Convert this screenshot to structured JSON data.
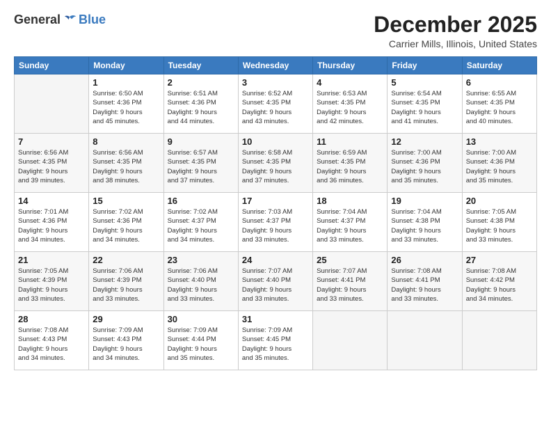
{
  "header": {
    "logo_general": "General",
    "logo_blue": "Blue",
    "title": "December 2025",
    "location": "Carrier Mills, Illinois, United States"
  },
  "days_of_week": [
    "Sunday",
    "Monday",
    "Tuesday",
    "Wednesday",
    "Thursday",
    "Friday",
    "Saturday"
  ],
  "weeks": [
    [
      {
        "day": "",
        "info": ""
      },
      {
        "day": "1",
        "info": "Sunrise: 6:50 AM\nSunset: 4:36 PM\nDaylight: 9 hours\nand 45 minutes."
      },
      {
        "day": "2",
        "info": "Sunrise: 6:51 AM\nSunset: 4:36 PM\nDaylight: 9 hours\nand 44 minutes."
      },
      {
        "day": "3",
        "info": "Sunrise: 6:52 AM\nSunset: 4:35 PM\nDaylight: 9 hours\nand 43 minutes."
      },
      {
        "day": "4",
        "info": "Sunrise: 6:53 AM\nSunset: 4:35 PM\nDaylight: 9 hours\nand 42 minutes."
      },
      {
        "day": "5",
        "info": "Sunrise: 6:54 AM\nSunset: 4:35 PM\nDaylight: 9 hours\nand 41 minutes."
      },
      {
        "day": "6",
        "info": "Sunrise: 6:55 AM\nSunset: 4:35 PM\nDaylight: 9 hours\nand 40 minutes."
      }
    ],
    [
      {
        "day": "7",
        "info": "Sunrise: 6:56 AM\nSunset: 4:35 PM\nDaylight: 9 hours\nand 39 minutes."
      },
      {
        "day": "8",
        "info": "Sunrise: 6:56 AM\nSunset: 4:35 PM\nDaylight: 9 hours\nand 38 minutes."
      },
      {
        "day": "9",
        "info": "Sunrise: 6:57 AM\nSunset: 4:35 PM\nDaylight: 9 hours\nand 37 minutes."
      },
      {
        "day": "10",
        "info": "Sunrise: 6:58 AM\nSunset: 4:35 PM\nDaylight: 9 hours\nand 37 minutes."
      },
      {
        "day": "11",
        "info": "Sunrise: 6:59 AM\nSunset: 4:35 PM\nDaylight: 9 hours\nand 36 minutes."
      },
      {
        "day": "12",
        "info": "Sunrise: 7:00 AM\nSunset: 4:36 PM\nDaylight: 9 hours\nand 35 minutes."
      },
      {
        "day": "13",
        "info": "Sunrise: 7:00 AM\nSunset: 4:36 PM\nDaylight: 9 hours\nand 35 minutes."
      }
    ],
    [
      {
        "day": "14",
        "info": "Sunrise: 7:01 AM\nSunset: 4:36 PM\nDaylight: 9 hours\nand 34 minutes."
      },
      {
        "day": "15",
        "info": "Sunrise: 7:02 AM\nSunset: 4:36 PM\nDaylight: 9 hours\nand 34 minutes."
      },
      {
        "day": "16",
        "info": "Sunrise: 7:02 AM\nSunset: 4:37 PM\nDaylight: 9 hours\nand 34 minutes."
      },
      {
        "day": "17",
        "info": "Sunrise: 7:03 AM\nSunset: 4:37 PM\nDaylight: 9 hours\nand 33 minutes."
      },
      {
        "day": "18",
        "info": "Sunrise: 7:04 AM\nSunset: 4:37 PM\nDaylight: 9 hours\nand 33 minutes."
      },
      {
        "day": "19",
        "info": "Sunrise: 7:04 AM\nSunset: 4:38 PM\nDaylight: 9 hours\nand 33 minutes."
      },
      {
        "day": "20",
        "info": "Sunrise: 7:05 AM\nSunset: 4:38 PM\nDaylight: 9 hours\nand 33 minutes."
      }
    ],
    [
      {
        "day": "21",
        "info": "Sunrise: 7:05 AM\nSunset: 4:39 PM\nDaylight: 9 hours\nand 33 minutes."
      },
      {
        "day": "22",
        "info": "Sunrise: 7:06 AM\nSunset: 4:39 PM\nDaylight: 9 hours\nand 33 minutes."
      },
      {
        "day": "23",
        "info": "Sunrise: 7:06 AM\nSunset: 4:40 PM\nDaylight: 9 hours\nand 33 minutes."
      },
      {
        "day": "24",
        "info": "Sunrise: 7:07 AM\nSunset: 4:40 PM\nDaylight: 9 hours\nand 33 minutes."
      },
      {
        "day": "25",
        "info": "Sunrise: 7:07 AM\nSunset: 4:41 PM\nDaylight: 9 hours\nand 33 minutes."
      },
      {
        "day": "26",
        "info": "Sunrise: 7:08 AM\nSunset: 4:41 PM\nDaylight: 9 hours\nand 33 minutes."
      },
      {
        "day": "27",
        "info": "Sunrise: 7:08 AM\nSunset: 4:42 PM\nDaylight: 9 hours\nand 34 minutes."
      }
    ],
    [
      {
        "day": "28",
        "info": "Sunrise: 7:08 AM\nSunset: 4:43 PM\nDaylight: 9 hours\nand 34 minutes."
      },
      {
        "day": "29",
        "info": "Sunrise: 7:09 AM\nSunset: 4:43 PM\nDaylight: 9 hours\nand 34 minutes."
      },
      {
        "day": "30",
        "info": "Sunrise: 7:09 AM\nSunset: 4:44 PM\nDaylight: 9 hours\nand 35 minutes."
      },
      {
        "day": "31",
        "info": "Sunrise: 7:09 AM\nSunset: 4:45 PM\nDaylight: 9 hours\nand 35 minutes."
      },
      {
        "day": "",
        "info": ""
      },
      {
        "day": "",
        "info": ""
      },
      {
        "day": "",
        "info": ""
      }
    ]
  ]
}
